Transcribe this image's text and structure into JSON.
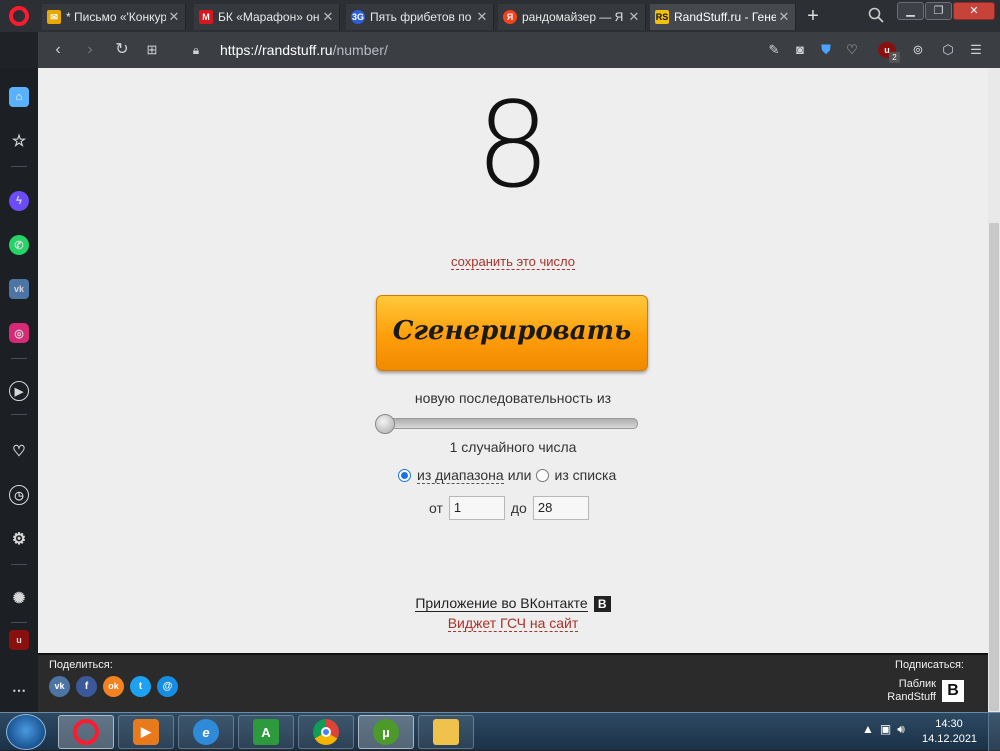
{
  "browser": {
    "tabs": [
      {
        "label": "* Письмо «'Конкур",
        "favicon": "mail-icon",
        "color": "#e8a800"
      },
      {
        "label": "БК «Марафон» он",
        "favicon": "marathon-icon",
        "color": "#d7161e"
      },
      {
        "label": "Пять фрибетов по",
        "favicon": "site-icon",
        "color": "#2b5fd9"
      },
      {
        "label": "рандомайзер — Я",
        "favicon": "yandex-icon",
        "color": "#fc3f1d"
      },
      {
        "label": "RandStuff.ru - Гене",
        "favicon": "randstuff-icon",
        "color": "#f3c10b",
        "active": true
      }
    ],
    "favicon_text": [
      "✉",
      "M",
      "3G",
      "Я",
      "RS"
    ],
    "new_tab": "+",
    "url_host": "https://randstuff.ru",
    "url_path": "/number/",
    "badge_count": "2"
  },
  "page": {
    "result_number": "8",
    "save_link": "сохранить это число",
    "generate_button": "Сгенерировать",
    "sequence_label": "новую последовательность из",
    "slider_value": 1,
    "count_label": "1 случайного числа",
    "mode_range": "из диапазона",
    "mode_range_suffix": "или",
    "mode_list": "из списка",
    "from_label": "от",
    "from_value": "1",
    "to_label": "до",
    "to_value": "28",
    "vk_app": "Приложение во ВКонтакте",
    "vk_badge": "B",
    "widget_link": "Виджет ГСЧ на сайт"
  },
  "footer": {
    "share_label": "Поделиться:",
    "share_icons": [
      {
        "name": "vk-share-icon",
        "text": "vk",
        "color": "#4c75a3"
      },
      {
        "name": "facebook-share-icon",
        "text": "f",
        "color": "#3b5998"
      },
      {
        "name": "odnoklassniki-share-icon",
        "text": "ok",
        "color": "#f58220"
      },
      {
        "name": "twitter-share-icon",
        "text": "t",
        "color": "#1da1f2"
      },
      {
        "name": "moimir-share-icon",
        "text": "@",
        "color": "#168de2"
      }
    ],
    "subscribe_label": "Подписаться:",
    "public_line1": "Паблик",
    "public_line2": "RandStuff",
    "public_badge": "B"
  },
  "taskbar": {
    "time": "14:30",
    "date": "14.12.2021"
  }
}
